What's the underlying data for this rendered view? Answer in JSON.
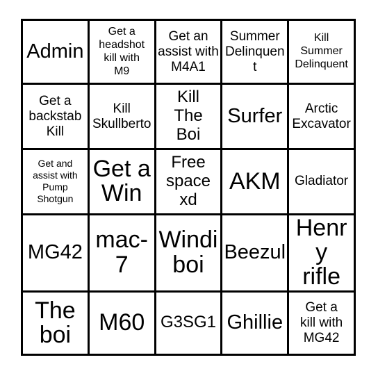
{
  "card": {
    "type": "bingo-card",
    "grid": {
      "rows": 5,
      "cols": 5
    },
    "colors": {
      "border": "#000000",
      "background": "#ffffff",
      "text": "#000000"
    },
    "free_space_label": "Free\nspace\nxd",
    "cells": [
      [
        {
          "name": "cell-r1c1",
          "text": "Admin",
          "size": "xl"
        },
        {
          "name": "cell-r1c2",
          "text": "Get a\nheadshot\nkill with\nM9",
          "size": "s"
        },
        {
          "name": "cell-r1c3",
          "text": "Get an\nassist with\nM4A1",
          "size": "m"
        },
        {
          "name": "cell-r1c4",
          "text": "Summer\nDelinquent",
          "size": "m"
        },
        {
          "name": "cell-r1c5",
          "text": "Kill\nSummer\nDelinquent",
          "size": "s"
        }
      ],
      [
        {
          "name": "cell-r2c1",
          "text": "Get a\nbackstab\nKill",
          "size": "m"
        },
        {
          "name": "cell-r2c2",
          "text": "Kill\nSkullberto",
          "size": "m"
        },
        {
          "name": "cell-r2c3",
          "text": "Kill\nThe\nBoi",
          "size": "l"
        },
        {
          "name": "cell-r2c4",
          "text": "Surfer",
          "size": "xl"
        },
        {
          "name": "cell-r2c5",
          "text": "Arctic\nExcavator",
          "size": "m"
        }
      ],
      [
        {
          "name": "cell-r3c1",
          "text": "Get and\nassist with\nPump\nShotgun",
          "size": "xs"
        },
        {
          "name": "cell-r3c2",
          "text": "Get a\nWin",
          "size": "xxl"
        },
        {
          "name": "cell-r3c3",
          "text": "Free\nspace\nxd",
          "size": "l"
        },
        {
          "name": "cell-r3c4",
          "text": "AKM",
          "size": "xxl"
        },
        {
          "name": "cell-r3c5",
          "text": "Gladiator",
          "size": "m"
        }
      ],
      [
        {
          "name": "cell-r4c1",
          "text": "MG42",
          "size": "xl"
        },
        {
          "name": "cell-r4c2",
          "text": "mac-7",
          "size": "xxl"
        },
        {
          "name": "cell-r4c3",
          "text": "Windi\nboi",
          "size": "xxl"
        },
        {
          "name": "cell-r4c4",
          "text": "Beezul",
          "size": "xl"
        },
        {
          "name": "cell-r4c5",
          "text": "Henry\nrifle",
          "size": "xxl"
        }
      ],
      [
        {
          "name": "cell-r5c1",
          "text": "The\nboi",
          "size": "xxl"
        },
        {
          "name": "cell-r5c2",
          "text": "M60",
          "size": "xxl"
        },
        {
          "name": "cell-r5c3",
          "text": "G3SG1",
          "size": "l"
        },
        {
          "name": "cell-r5c4",
          "text": "Ghillie",
          "size": "xl"
        },
        {
          "name": "cell-r5c5",
          "text": "Get a\nkill with\nMG42",
          "size": "m"
        }
      ]
    ]
  }
}
